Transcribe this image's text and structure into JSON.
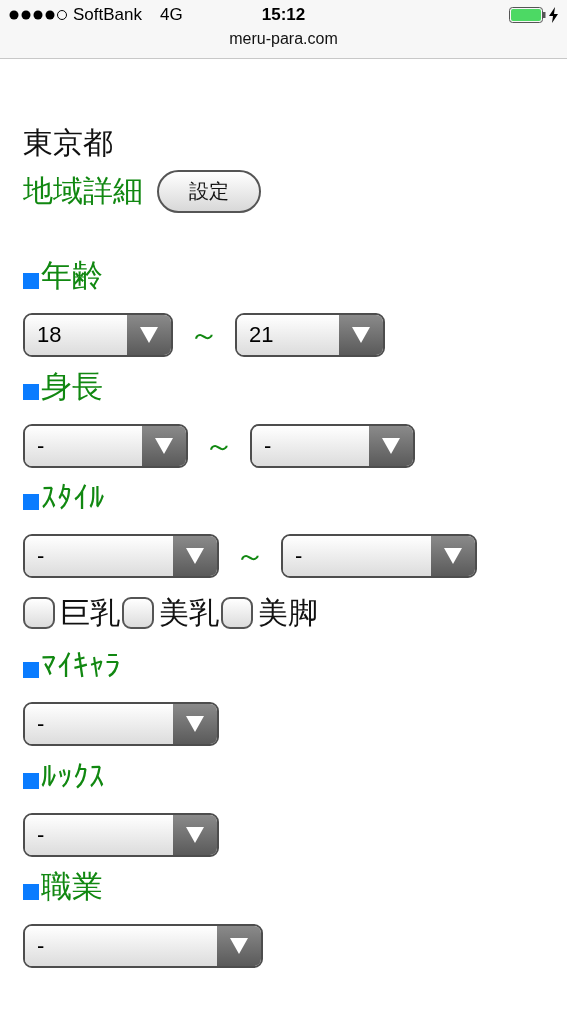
{
  "status_bar": {
    "carrier": "SoftBank",
    "network": "4G",
    "time": "15:12"
  },
  "address_bar": {
    "url": "meru-para.com"
  },
  "prefecture": {
    "value": "東京都"
  },
  "region": {
    "label": "地域詳細",
    "button": "設定"
  },
  "sections": [
    {
      "kind": "range",
      "title": "年齢",
      "from": "18",
      "separator": "～",
      "to": "21"
    },
    {
      "kind": "range",
      "title": "身長",
      "from": "-",
      "separator": "～",
      "to": "-"
    },
    {
      "kind": "range",
      "title": "ｽﾀｲﾙ",
      "from": "-",
      "separator": "～",
      "to": "-",
      "options": [
        {
          "label": "巨乳",
          "checked": false
        },
        {
          "label": "美乳",
          "checked": false
        },
        {
          "label": "美脚",
          "checked": false
        }
      ]
    },
    {
      "kind": "single",
      "title": "ﾏｲｷｬﾗ",
      "value": "-"
    },
    {
      "kind": "single",
      "title": "ﾙｯｸｽ",
      "value": "-"
    },
    {
      "kind": "single",
      "title": "職業",
      "value": "-"
    }
  ]
}
